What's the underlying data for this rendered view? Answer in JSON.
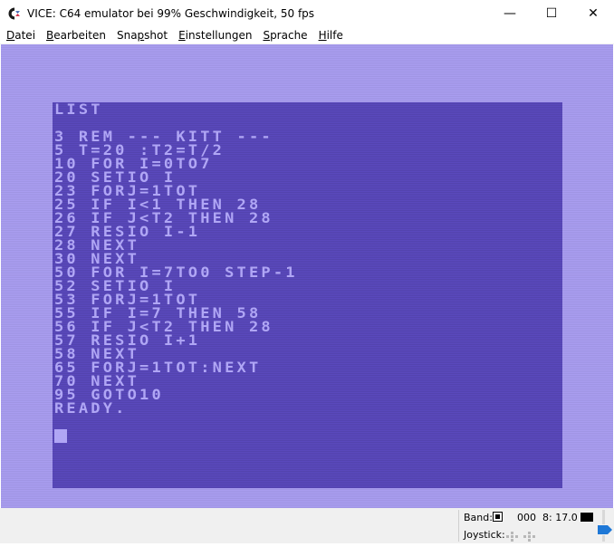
{
  "window": {
    "title": "VICE: C64 emulator bei 99% Geschwindigkeit, 50 fps",
    "minimize": "—",
    "maximize": "☐",
    "close": "✕"
  },
  "menu": [
    {
      "pre": "",
      "key": "D",
      "post": "atei"
    },
    {
      "pre": "",
      "key": "B",
      "post": "earbeiten"
    },
    {
      "pre": "Sna",
      "key": "p",
      "post": "shot"
    },
    {
      "pre": "",
      "key": "E",
      "post": "instellungen"
    },
    {
      "pre": "",
      "key": "S",
      "post": "prache"
    },
    {
      "pre": "",
      "key": "H",
      "post": "ilfe"
    }
  ],
  "screen": {
    "lines": [
      "LIST",
      "",
      "3 REM --- KITT ---",
      "5 T=20 :T2=T/2",
      "10 FOR I=0TO7",
      "20 SETIO I",
      "23 FORJ=1TOT",
      "25 IF I<1 THEN 28",
      "26 IF J<T2 THEN 28",
      "27 RESIO I-1",
      "28 NEXT",
      "30 NEXT",
      "50 FOR I=7TO0 STEP-1",
      "52 SETIO I",
      "53 FORJ=1TOT",
      "55 IF I=7 THEN 58",
      "56 IF J<T2 THEN 28",
      "57 RESIO I+1",
      "58 NEXT",
      "65 FORJ=1TOT:NEXT",
      "70 NEXT",
      "95 GOTO10",
      "READY."
    ]
  },
  "status": {
    "band_label": "Band:",
    "tape_counter": "000",
    "drive": "8: 17.0",
    "joystick_label": "Joystick:"
  },
  "colors": {
    "border": "#a99df0",
    "screen": "#5a49bd",
    "text": "#b0a6f5",
    "accent_blue": "#1e78d7"
  }
}
